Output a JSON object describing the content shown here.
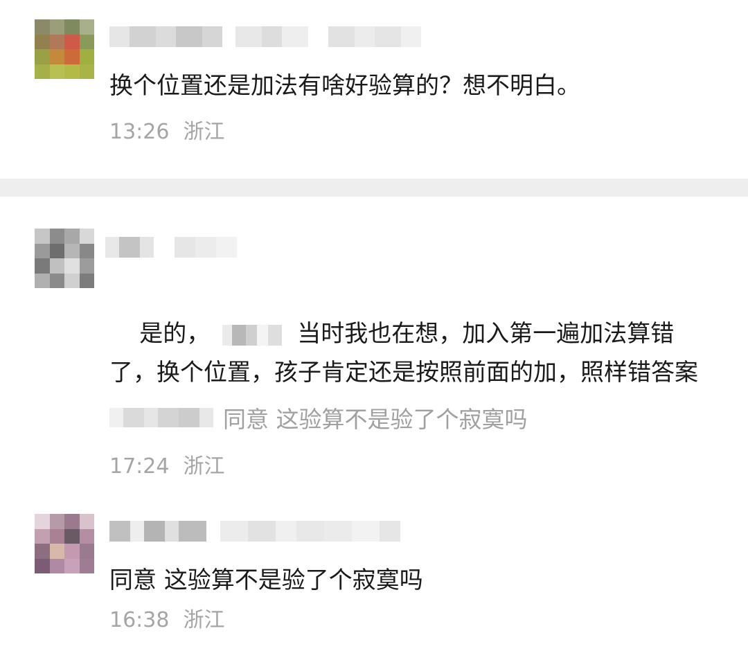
{
  "comments": [
    {
      "text": "换个位置还是加法有啥好验算的？想不明白。",
      "time": "13:26",
      "region": "浙江"
    },
    {
      "text_prefix": "是的，",
      "text_suffix": "当时我也在想，加入第一遍加法算错了，换个位置，孩子肯定还是按照前面的加，照样错答案",
      "reply_text": "同意 这验算不是验了个寂寞吗",
      "time": "17:24",
      "region": "浙江"
    },
    {
      "text": "同意 这验算不是验了个寂寞吗",
      "time": "16:38",
      "region": "浙江"
    }
  ],
  "colors": {
    "text": "#1a1a1a",
    "meta": "#a5a5a5",
    "divider": "#eeeeee"
  }
}
